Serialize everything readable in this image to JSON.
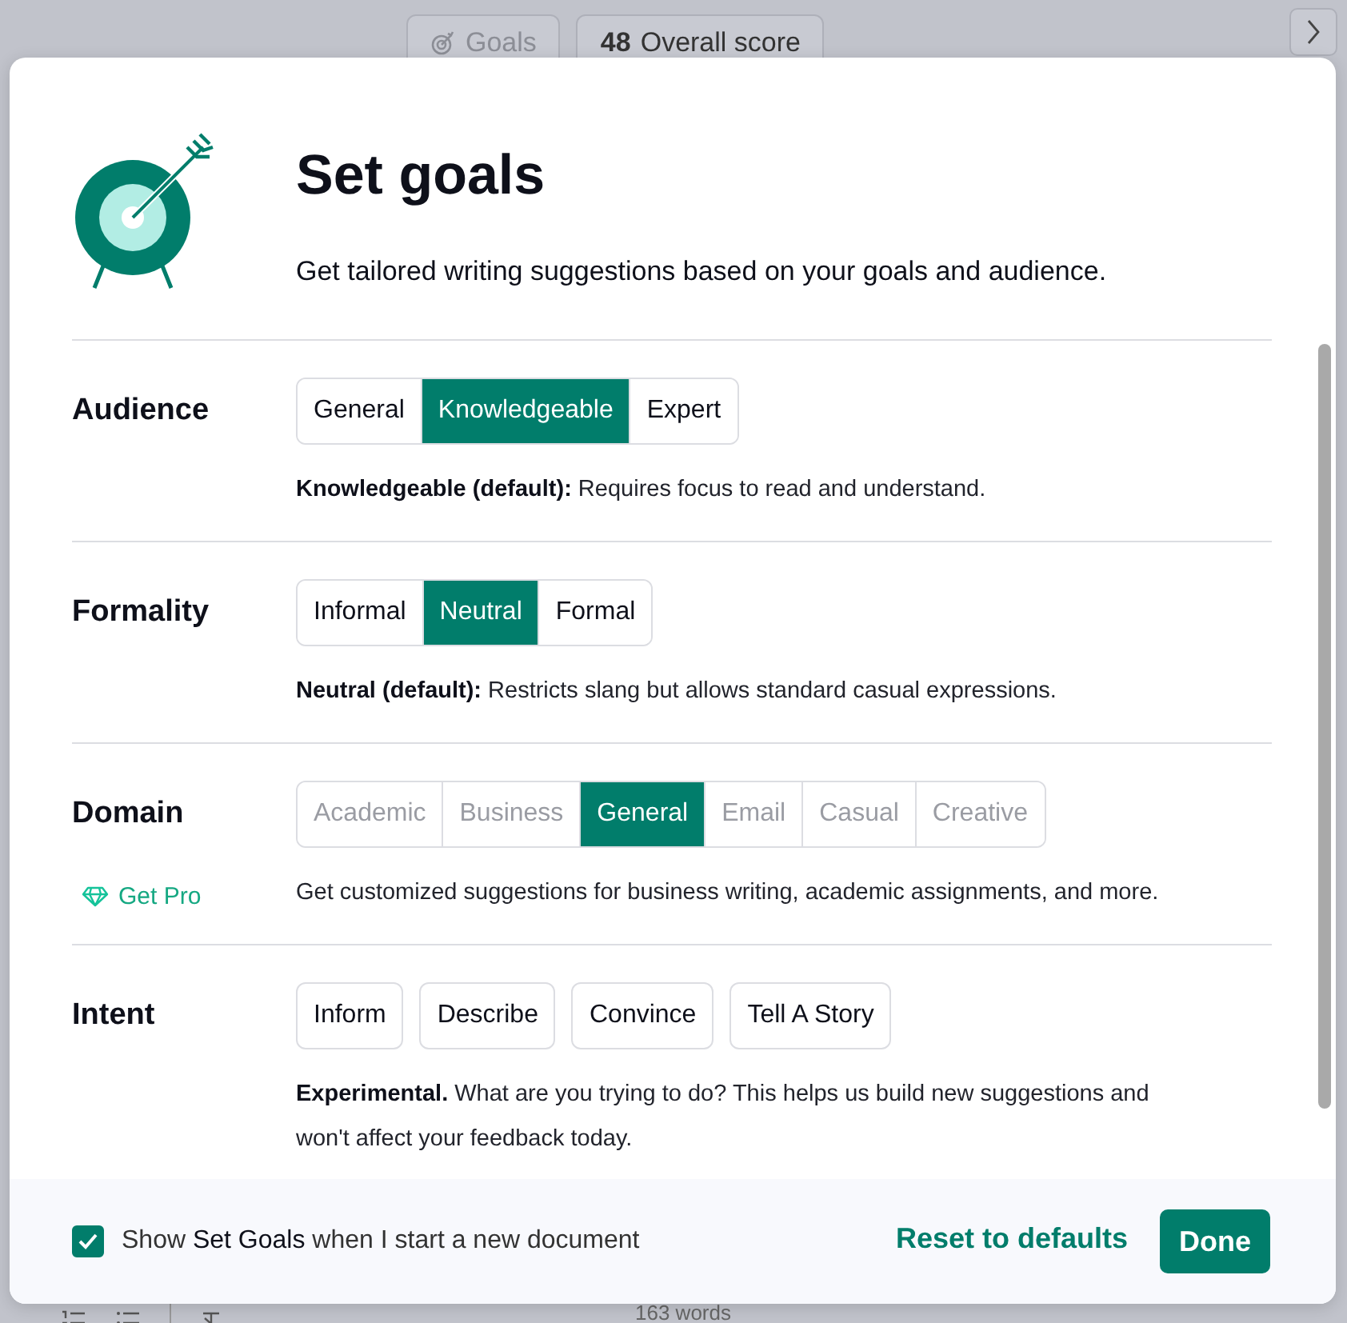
{
  "toolbar": {
    "goals_button": {
      "label": "Goals",
      "disabled": true
    },
    "score": {
      "value": "48",
      "label": "Overall score"
    }
  },
  "dialog": {
    "title": "Set goals",
    "subtitle": "Get tailored writing suggestions based on your goals and audience.",
    "sections": [
      {
        "label": "Audience",
        "kind": "segmented",
        "options": [
          {
            "label": "General",
            "selected": false,
            "disabled": false
          },
          {
            "label": "Knowledgeable",
            "selected": true,
            "disabled": false
          },
          {
            "label": "Expert",
            "selected": false,
            "disabled": false
          }
        ],
        "description": "**Knowledgeable (default):** Requires focus to read and understand."
      },
      {
        "label": "Formality",
        "kind": "segmented",
        "options": [
          {
            "label": "Informal",
            "selected": false,
            "disabled": false
          },
          {
            "label": "Neutral",
            "selected": true,
            "disabled": false
          },
          {
            "label": "Formal",
            "selected": false,
            "disabled": false
          }
        ],
        "description": "**Neutral (default):** Restricts slang but allows standard casual expressions."
      },
      {
        "label": "Domain",
        "kind": "segmented",
        "upsell": "Get Pro",
        "options": [
          {
            "label": "Academic",
            "selected": false,
            "disabled": true
          },
          {
            "label": "Business",
            "selected": false,
            "disabled": true
          },
          {
            "label": "General",
            "selected": true,
            "disabled": false
          },
          {
            "label": "Email",
            "selected": false,
            "disabled": true
          },
          {
            "label": "Casual",
            "selected": false,
            "disabled": true
          },
          {
            "label": "Creative",
            "selected": false,
            "disabled": true
          }
        ],
        "description": "Get customized suggestions for business writing, academic assignments, and more."
      },
      {
        "label": "Intent",
        "kind": "separate",
        "options": [
          {
            "label": "Inform",
            "selected": false,
            "disabled": false
          },
          {
            "label": "Describe",
            "selected": false,
            "disabled": false
          },
          {
            "label": "Convince",
            "selected": false,
            "disabled": false
          },
          {
            "label": "Tell A Story",
            "selected": false,
            "disabled": false
          }
        ],
        "description": "**Experimental.** What are you trying to do? This helps us build new suggestions and won't affect your feedback today."
      }
    ],
    "footer": {
      "show_on_start": {
        "label": "Show **Set Goals** when I start a new document",
        "checked": true
      },
      "reset": "Reset to defaults",
      "done": "Done"
    }
  },
  "status_bar": {
    "word_count": "163 words"
  }
}
